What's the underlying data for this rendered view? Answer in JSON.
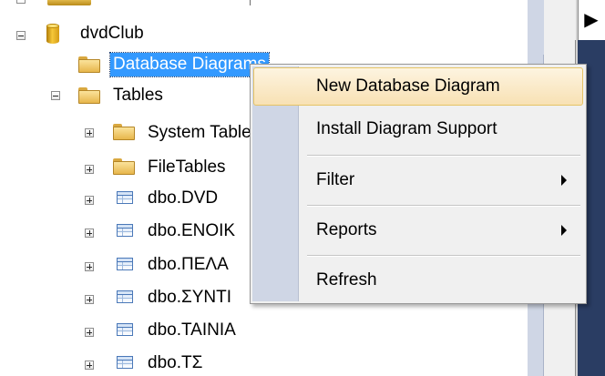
{
  "tree": {
    "database": "dvdClub",
    "items": [
      {
        "label": "Database Diagrams",
        "selected": true
      },
      {
        "label": "Tables"
      },
      {
        "label": "System Tables"
      },
      {
        "label": "FileTables"
      },
      {
        "label": "dbo.DVD"
      },
      {
        "label": "dbo.ΕΝΟΙΚ"
      },
      {
        "label": "dbo.ΠΕΛΑ"
      },
      {
        "label": "dbo.ΣΥΝΤΙ"
      },
      {
        "label": "dbo.ΤΑΙΝΙΑ"
      },
      {
        "label": "dbo.ΤΣ"
      }
    ]
  },
  "context_menu": {
    "items": [
      {
        "label": "New Database Diagram",
        "highlighted": true
      },
      {
        "label": "Install Diagram Support"
      },
      {
        "label": "Filter",
        "submenu": true
      },
      {
        "label": "Reports",
        "submenu": true
      },
      {
        "label": "Refresh"
      }
    ]
  },
  "colors": {
    "selection": "#3399ff",
    "menu_highlight": "#f8e1b4",
    "menu_gutter": "#cfd6e5",
    "panel_dark": "#2a3d63"
  }
}
